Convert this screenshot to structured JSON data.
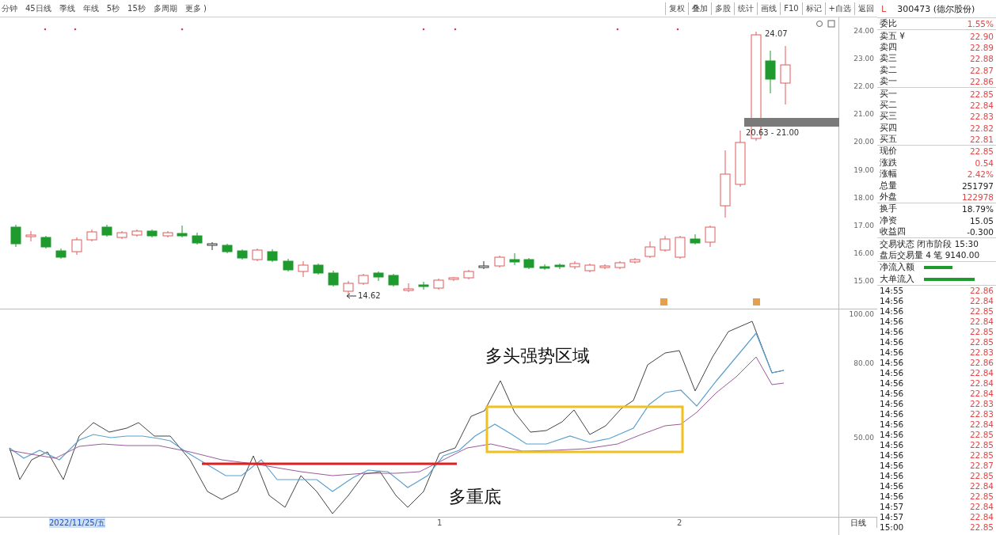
{
  "toolbar": {
    "periods": [
      "分钟",
      "45日线",
      "季线",
      "年线",
      "5秒",
      "15秒",
      "多周期",
      "更多 )"
    ],
    "tools": [
      "复权",
      "叠加",
      "多股",
      "统计",
      "画线",
      "F10",
      "标记",
      "+自选",
      "返回"
    ]
  },
  "price_chart": {
    "axis_ticks": [
      "24.00",
      "23.00",
      "22.00",
      "21.00",
      "20.00",
      "19.00",
      "18.00",
      "17.00",
      "16.00",
      "15.00"
    ],
    "low_label": "14.62",
    "high_label": "24.07",
    "range_label": "20.63 - 21.00"
  },
  "indicator_chart": {
    "axis_ticks": [
      "100.00",
      "80.00",
      "50.00"
    ],
    "annotations": [
      "多头强势区域",
      "多重底"
    ]
  },
  "date_axis": {
    "labels": [
      {
        "label": "2022/11/25/五",
        "selected": true
      },
      {
        "label": "1",
        "selected": false
      },
      {
        "label": "2",
        "selected": false
      }
    ],
    "period": "日线"
  },
  "quote": {
    "flag": "L",
    "title": "300473 (德尔股份)",
    "groups": [
      [
        {
          "label": "委比",
          "value": "1.55%",
          "color": "#e04848"
        }
      ],
      [
        {
          "label": "卖五 ¥",
          "value": "22.90",
          "color": "#e04848"
        },
        {
          "label": "卖四",
          "value": "22.89",
          "color": "#e04848"
        },
        {
          "label": "卖三",
          "value": "22.88",
          "color": "#e04848"
        },
        {
          "label": "卖二",
          "value": "22.87",
          "color": "#e04848"
        },
        {
          "label": "卖一",
          "value": "22.86",
          "color": "#e04848"
        }
      ],
      [
        {
          "label": "买一",
          "value": "22.85",
          "color": "#e04848"
        },
        {
          "label": "买二",
          "value": "22.84",
          "color": "#e04848"
        },
        {
          "label": "买三",
          "value": "22.83",
          "color": "#e04848"
        },
        {
          "label": "买四",
          "value": "22.82",
          "color": "#e04848"
        },
        {
          "label": "买五",
          "value": "22.81",
          "color": "#e04848"
        }
      ],
      [
        {
          "label": "现价",
          "value": "22.85",
          "color": "#e04848"
        },
        {
          "label": "涨跌",
          "value": "0.54",
          "color": "#e04848"
        },
        {
          "label": "涨幅",
          "value": "2.42%",
          "color": "#e04848"
        },
        {
          "label": "总量",
          "value": "251797",
          "color": "#222222"
        },
        {
          "label": "外盘",
          "value": "122978",
          "color": "#e04848"
        }
      ],
      [
        {
          "label": "换手",
          "value": "18.79%",
          "color": "#222222"
        },
        {
          "label": "净资",
          "value": "15.05",
          "color": "#222222"
        },
        {
          "label": "收益四",
          "value": "-0.300",
          "color": "#222222"
        }
      ]
    ],
    "status": [
      "交易状态 闭市阶段 15:30",
      "盘后交易量 4 笔 9140.00"
    ],
    "flows": [
      {
        "label": "净流入额"
      },
      {
        "label": "大单流入"
      }
    ]
  },
  "ticks": [
    {
      "time": "14:55",
      "price": "22.86"
    },
    {
      "time": "14:56",
      "price": "22.84"
    },
    {
      "time": "14:56",
      "price": "22.85"
    },
    {
      "time": "14:56",
      "price": "22.84"
    },
    {
      "time": "14:56",
      "price": "22.85"
    },
    {
      "time": "14:56",
      "price": "22.85"
    },
    {
      "time": "14:56",
      "price": "22.83"
    },
    {
      "time": "14:56",
      "price": "22.86"
    },
    {
      "time": "14:56",
      "price": "22.84"
    },
    {
      "time": "14:56",
      "price": "22.84"
    },
    {
      "time": "14:56",
      "price": "22.84"
    },
    {
      "time": "14:56",
      "price": "22.83"
    },
    {
      "time": "14:56",
      "price": "22.83"
    },
    {
      "time": "14:56",
      "price": "22.84"
    },
    {
      "time": "14:56",
      "price": "22.85"
    },
    {
      "time": "14:56",
      "price": "22.85"
    },
    {
      "time": "14:56",
      "price": "22.85"
    },
    {
      "time": "14:56",
      "price": "22.87"
    },
    {
      "time": "14:56",
      "price": "22.85"
    },
    {
      "time": "14:56",
      "price": "22.84"
    },
    {
      "time": "14:56",
      "price": "22.85"
    },
    {
      "time": "14:57",
      "price": "22.84"
    },
    {
      "time": "14:57",
      "price": "22.84"
    },
    {
      "time": "15:00",
      "price": "22.85"
    }
  ]
}
